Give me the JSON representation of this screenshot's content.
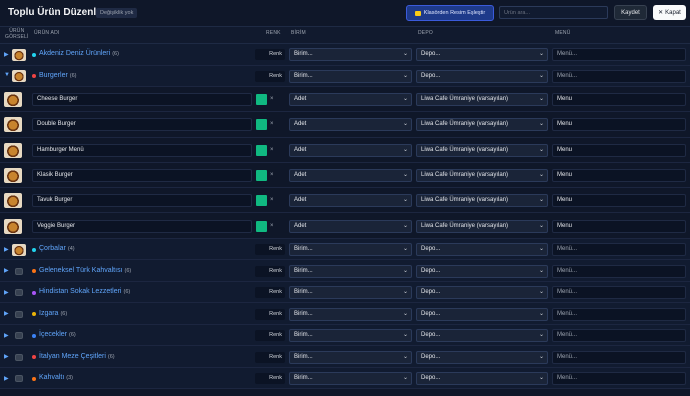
{
  "header": {
    "title": "Toplu Ürün Düzenleme",
    "badge": "Değişiklik yok",
    "match_button": "Klasörden Resim Eşleştir",
    "search_placeholder": "Ürün ara...",
    "save_label": "Kaydet",
    "close_label": "Kapat"
  },
  "columns": {
    "image": "ÜRÜN\nGÖRSELİ",
    "name": "ÜRÜN ADI",
    "color": "RENK",
    "unit": "BİRİM",
    "depot": "DEPO",
    "menu": "MENÜ"
  },
  "defaults": {
    "color_label": "Renk",
    "unit_placeholder": "Birim...",
    "depot_placeholder": "Depo...",
    "menu_placeholder": "Menü...",
    "swatch_clear": "×",
    "collapsed_arrow": "▶",
    "expanded_arrow": "▼",
    "chevron": "⌄"
  },
  "swatch_color": "#10b981",
  "categories": [
    {
      "name": "Akdeniz Deniz Ürünleri",
      "count": "(6)",
      "dot": "#22d3ee",
      "expanded": false,
      "image": "food"
    },
    {
      "name": "Burgerler",
      "count": "(6)",
      "dot": "#ef4444",
      "expanded": true,
      "image": "food",
      "products": [
        {
          "name": "Cheese Burger",
          "unit": "Adet",
          "depot": "Liwa Cafe Ümraniye (varsayılan)",
          "menu": "Menu"
        },
        {
          "name": "Double Burger",
          "unit": "Adet",
          "depot": "Liwa Cafe Ümraniye (varsayılan)",
          "menu": "Menu"
        },
        {
          "name": "Hamburger Menü",
          "unit": "Adet",
          "depot": "Liwa Cafe Ümraniye (varsayılan)",
          "menu": "Menu"
        },
        {
          "name": "Klasik Burger",
          "unit": "Adet",
          "depot": "Liwa Cafe Ümraniye (varsayılan)",
          "menu": "Menu"
        },
        {
          "name": "Tavuk Burger",
          "unit": "Adet",
          "depot": "Liwa Cafe Ümraniye (varsayılan)",
          "menu": "Menu"
        },
        {
          "name": "Veggie Burger",
          "unit": "Adet",
          "depot": "Liwa Cafe Ümraniye (varsayılan)",
          "menu": "Menu"
        }
      ]
    },
    {
      "name": "Çorbalar",
      "count": "(4)",
      "dot": "#22d3ee",
      "expanded": false,
      "image": "food"
    },
    {
      "name": "Geleneksel Türk Kahvaltısı",
      "count": "(6)",
      "dot": "#f97316",
      "expanded": false,
      "image": "placeholder"
    },
    {
      "name": "Hindistan Sokak Lezzetleri",
      "count": "(6)",
      "dot": "#a855f7",
      "expanded": false,
      "image": "placeholder"
    },
    {
      "name": "Izgara",
      "count": "(6)",
      "dot": "#eab308",
      "expanded": false,
      "image": "placeholder"
    },
    {
      "name": "İçecekler",
      "count": "(6)",
      "dot": "#3b82f6",
      "expanded": false,
      "image": "placeholder"
    },
    {
      "name": "İtalyan Meze Çeşitleri",
      "count": "(6)",
      "dot": "#ef4444",
      "expanded": false,
      "image": "placeholder"
    },
    {
      "name": "Kahvaltı",
      "count": "(3)",
      "dot": "#f97316",
      "expanded": false,
      "image": "placeholder"
    }
  ]
}
